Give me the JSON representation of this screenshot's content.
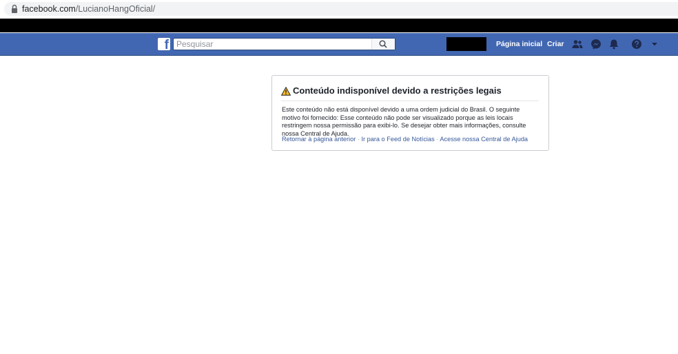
{
  "browser": {
    "url_domain": "facebook.com",
    "url_path": "/LucianoHangOficial/",
    "lock_icon": "lock-icon"
  },
  "header": {
    "logo_letter": "f",
    "search_placeholder": "Pesquisar",
    "search_value": "",
    "nav_home": "Página inicial",
    "nav_create": "Criar",
    "icons": [
      "friends-icon",
      "messenger-icon",
      "bell-icon",
      "help-icon",
      "caret-down-icon"
    ],
    "bar_color": "#4267b2"
  },
  "notice": {
    "title": "Conteúdo indisponível devido a restrições legais",
    "body": "Este conteúdo não está disponível devido a uma ordem judicial do Brasil. O seguinte motivo foi fornecido: Esse conteúdo não pode ser visualizado porque as leis locais restringem nossa permissão para exibi-lo. Se desejar obter mais informações, consulte nossa Central de Ajuda.",
    "link_back": "Retornar à página anterior",
    "link_feed": "Ir para o Feed de Notícias",
    "link_help": "Acesse nossa Central de Ajuda",
    "separator": "·",
    "warning_icon": "warning-icon"
  }
}
